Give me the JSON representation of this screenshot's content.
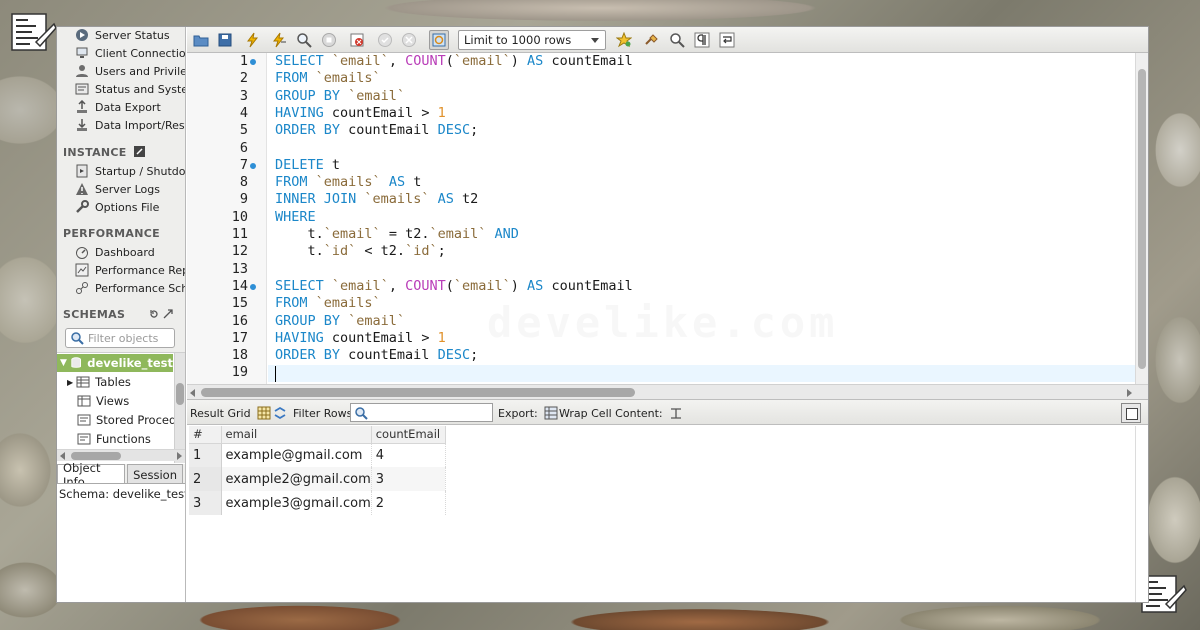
{
  "sidebar": {
    "management": [
      {
        "label": "Server Status",
        "icon": "server-status-icon"
      },
      {
        "label": "Client Connections",
        "icon": "client-connections-icon"
      },
      {
        "label": "Users and Privileges",
        "icon": "users-icon"
      },
      {
        "label": "Status and System Variables",
        "icon": "status-variables-icon"
      },
      {
        "label": "Data Export",
        "icon": "data-export-icon"
      },
      {
        "label": "Data Import/Restore",
        "icon": "data-import-icon"
      }
    ],
    "instance_header": "INSTANCE",
    "instance": [
      {
        "label": "Startup / Shutdown",
        "icon": "startup-shutdown-icon"
      },
      {
        "label": "Server Logs",
        "icon": "server-logs-icon"
      },
      {
        "label": "Options File",
        "icon": "options-file-icon"
      }
    ],
    "performance_header": "PERFORMANCE",
    "performance": [
      {
        "label": "Dashboard",
        "icon": "dashboard-icon"
      },
      {
        "label": "Performance Reports",
        "icon": "performance-reports-icon"
      },
      {
        "label": "Performance Schema Setup",
        "icon": "performance-schema-icon"
      }
    ],
    "schemas_header": "SCHEMAS",
    "filter_placeholder": "Filter objects",
    "schema_name": "develike_test",
    "schema_children": [
      "Tables",
      "Views",
      "Stored Procedures",
      "Functions"
    ],
    "info_tabs": [
      "Object Info",
      "Session"
    ],
    "info_text": "Schema: develike_test"
  },
  "toolbar": {
    "limit_select": "Limit to 1000 rows"
  },
  "editor": {
    "line_numbers": [
      "1",
      "2",
      "3",
      "4",
      "5",
      "6",
      "7",
      "8",
      "9",
      "10",
      "11",
      "12",
      "13",
      "14",
      "15",
      "16",
      "17",
      "18",
      "19"
    ],
    "watermark": "develike.com"
  },
  "results_toolbar": {
    "result_grid_label": "Result Grid",
    "filter_rows_label": "Filter Rows:",
    "export_label": "Export:",
    "wrap_label": "Wrap Cell Content:"
  },
  "grid": {
    "columns": [
      "#",
      "email",
      "countEmail"
    ],
    "rows": [
      [
        "1",
        "example@gmail.com",
        "4"
      ],
      [
        "2",
        "example2@gmail.com",
        "3"
      ],
      [
        "3",
        "example3@gmail.com",
        "2"
      ]
    ]
  },
  "colors": {
    "keyword": "#1b87c9",
    "function": "#b93db8",
    "identifier": "#8a6b3a",
    "number": "#e0912b",
    "selected_schema": "#8fb85c"
  }
}
